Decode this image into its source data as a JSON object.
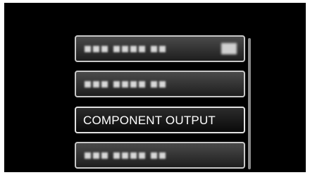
{
  "menu": {
    "items": [
      {
        "label": "",
        "blurred": true,
        "has_value": true
      },
      {
        "label": "",
        "blurred": true,
        "has_value": false
      },
      {
        "label": "COMPONENT OUTPUT",
        "blurred": false,
        "selected": true
      },
      {
        "label": "",
        "blurred": true,
        "has_value": false
      }
    ]
  },
  "colors": {
    "screen_background": "#000000",
    "item_border": "#c8c8c8",
    "selected_border": "#e2e2e2",
    "text": "#ffffff"
  }
}
